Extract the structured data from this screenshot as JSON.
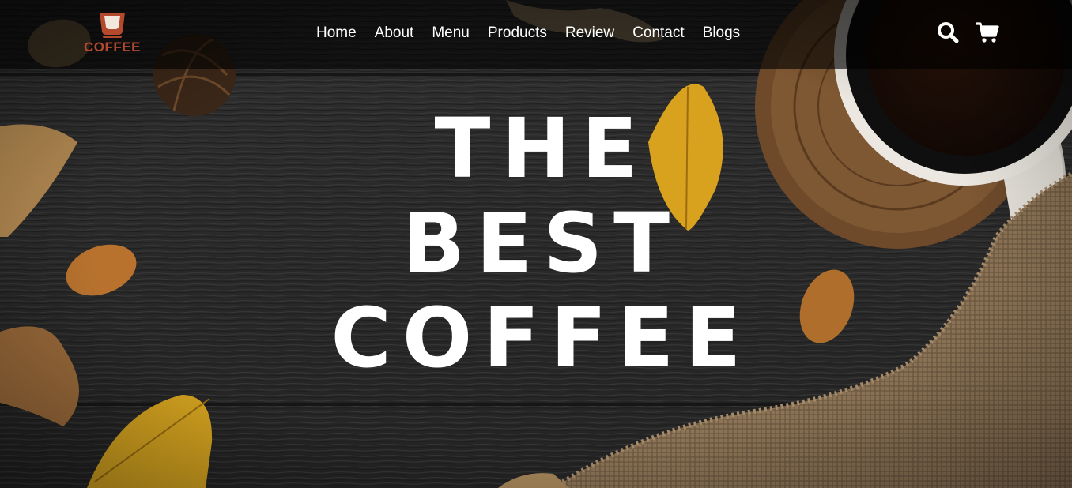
{
  "brand": {
    "logo_text": "COFFEE",
    "accent_color": "#b44a2d"
  },
  "nav": {
    "links": [
      "Home",
      "About",
      "Menu",
      "Products",
      "Review",
      "Contact",
      "Blogs"
    ],
    "icons": [
      "search-icon",
      "cart-icon"
    ]
  },
  "hero": {
    "lines": [
      "THE",
      "BEST",
      "COFFEE"
    ]
  },
  "colors": {
    "nav_text": "#ffffff",
    "hero_text": "#ffffff",
    "wood": "#2b2b2b"
  }
}
